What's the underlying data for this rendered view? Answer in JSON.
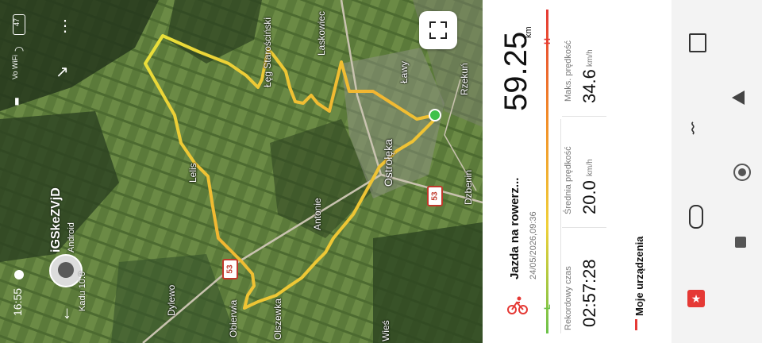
{
  "status": {
    "time": "16:55",
    "battery": "47",
    "network_label": "Vo WiFi"
  },
  "user": {
    "name": "iGSkeZVjD",
    "platform": "Android",
    "sub": "Kadu 10.0"
  },
  "map": {
    "places": [
      "Łęg Starościński",
      "Laskowiec",
      "Ławy",
      "Rzekuń",
      "Lelis",
      "Ostrołęka",
      "Antonie",
      "Dzbenin",
      "Dylewo",
      "Obierwia",
      "Olszewka",
      "Wieś"
    ],
    "road_badges": [
      "53",
      "53"
    ]
  },
  "activity": {
    "title": "Jazda na rowerz...",
    "datetime": "24/05/2026,09:36",
    "distance": "59.25",
    "distance_unit": "km",
    "record_time_label": "Rekordowy czas",
    "record_time_value": "02:57:28",
    "avg_speed_label": "Średnia prędkość",
    "avg_speed_value": "20.0",
    "avg_speed_unit": "km/h",
    "max_speed_label": "Maks. prędkość",
    "max_speed_value": "34.6",
    "max_speed_unit": "km/h",
    "scale_high": "H",
    "scale_low": "L"
  },
  "devices": {
    "label": "Moje urządzenia"
  },
  "colors": {
    "accent": "#e53935",
    "route_yellow": "#e5e53a",
    "route_orange": "#f08a1f",
    "start_green": "#3ec14a"
  }
}
